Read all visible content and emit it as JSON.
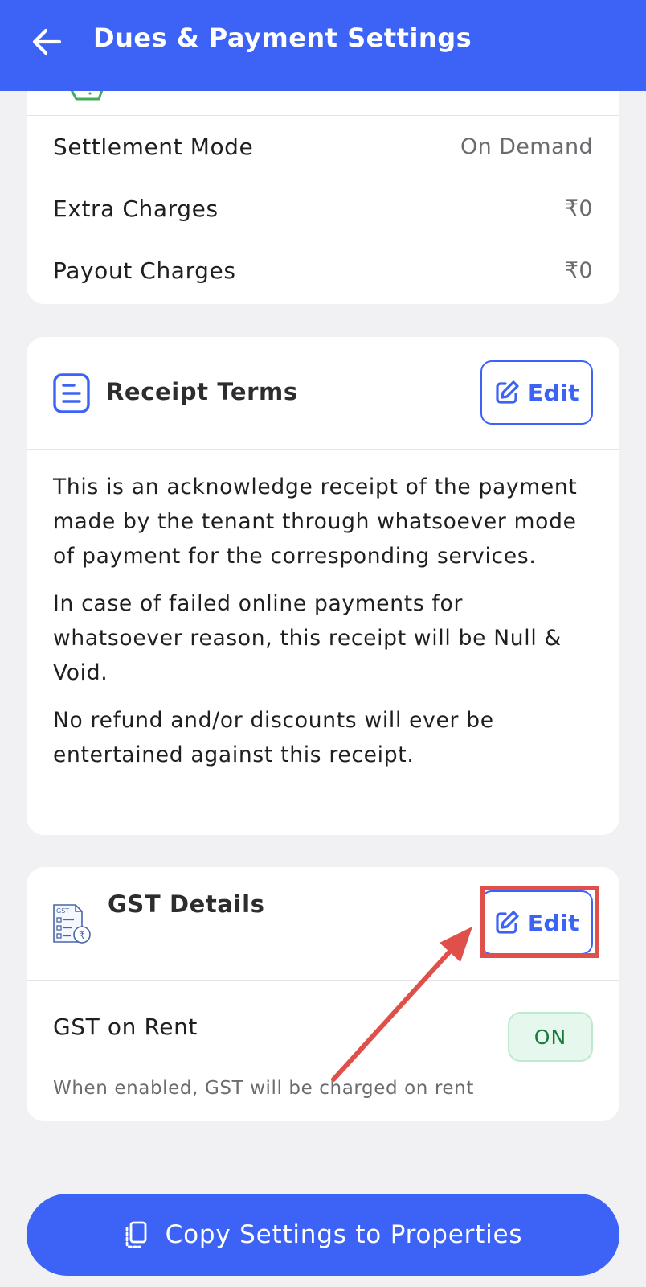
{
  "app_bar": {
    "title": "Dues & Payment Settings",
    "back_icon": "arrow-left-icon"
  },
  "settlement_card": {
    "rows": [
      {
        "label": "Settlement Mode",
        "value": "On Demand"
      },
      {
        "label": "Extra Charges",
        "value": "₹0"
      },
      {
        "label": "Payout Charges",
        "value": "₹0"
      }
    ]
  },
  "receipt_terms": {
    "title": "Receipt Terms",
    "icon": "document-list-icon",
    "edit_label": "Edit",
    "paragraphs": [
      "This is an acknowledge receipt of the payment made by the tenant through whatsoever mode of payment for the corresponding services.",
      "In case of failed online payments for whatsoever reason, this receipt will be Null & Void.",
      "No refund and/or discounts will ever be entertained against this receipt."
    ]
  },
  "gst_details": {
    "title": "GST Details",
    "icon": "gst-invoice-icon",
    "icon_text": "GST",
    "edit_label": "Edit",
    "gst_on_rent": {
      "label": "GST on Rent",
      "state": "ON",
      "helper": "When enabled, GST will be charged on rent"
    }
  },
  "footer": {
    "copy_label": "Copy Settings to Properties",
    "copy_icon": "copy-icon"
  },
  "colors": {
    "primary": "#3d63f6",
    "annotation": "#e0504b",
    "toggle_on_bg": "#e6f8ee",
    "toggle_on_text": "#177a3c"
  }
}
